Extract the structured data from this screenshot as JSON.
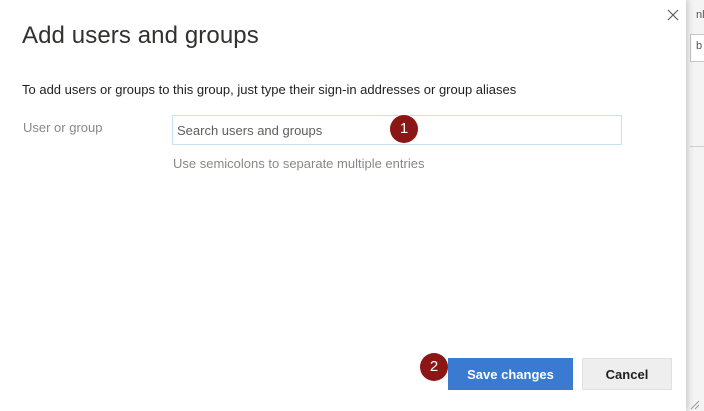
{
  "dialog": {
    "title": "Add users and groups",
    "instruction": "To add users or groups to this group, just type their sign-in addresses or group aliases",
    "field_label": "User or group",
    "search": {
      "placeholder": "Search users and groups",
      "value": ""
    },
    "hint": "Use semicolons to separate multiple entries",
    "save_label": "Save changes",
    "cancel_label": "Cancel",
    "close_icon": "close-icon"
  },
  "markers": [
    "1",
    "2"
  ],
  "background": {
    "fragment_top": "nl",
    "fragment_field": "b"
  },
  "colors": {
    "primary_button": "#3a7ad1",
    "marker": "#8c1515",
    "input_border": "#c7e0f4"
  }
}
